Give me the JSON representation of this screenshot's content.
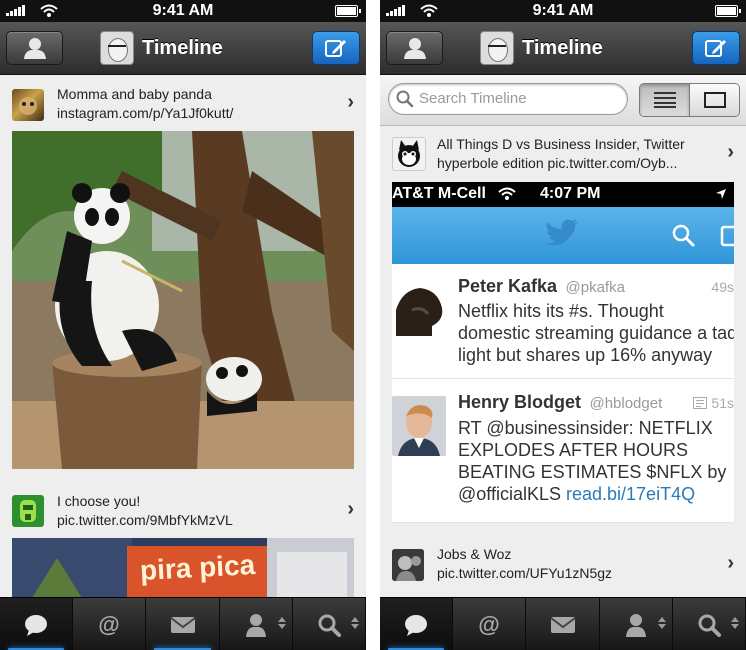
{
  "status_bar": {
    "time": "9:41 AM"
  },
  "nav": {
    "title": "Timeline"
  },
  "tabs": [
    {
      "name": "timeline",
      "icon": "speech-bubble-icon"
    },
    {
      "name": "mentions",
      "icon": "at-icon"
    },
    {
      "name": "messages",
      "icon": "envelope-icon"
    },
    {
      "name": "profile",
      "icon": "person-icon"
    },
    {
      "name": "search",
      "icon": "magnifier-icon"
    }
  ],
  "left": {
    "tweets": [
      {
        "line1": "Momma and baby panda",
        "line2": "instagram.com/p/Ya1Jf0kutt/"
      },
      {
        "line1": "I choose you!",
        "line2": "pic.twitter.com/9MbfYkMzVL"
      }
    ],
    "photo2_sign": "pira pica"
  },
  "right": {
    "search": {
      "placeholder": "Search Timeline"
    },
    "tweets": [
      {
        "line1": "All Things D vs Business Insider, Twitter",
        "line2": "hyperbole edition pic.twitter.com/Oyb..."
      },
      {
        "line1": "Jobs & Woz",
        "line2": "pic.twitter.com/UFYu1zN5gz"
      }
    ],
    "embed": {
      "carrier": "AT&T M-Cell",
      "time": "4:07 PM",
      "tweets": [
        {
          "name": "Peter Kafka",
          "handle": "@pkafka",
          "count": "49s",
          "lines": [
            "Netflix hits its #s. Thought",
            "domestic streaming guidance a tad",
            "light but shares up 16% anyway"
          ]
        },
        {
          "name": "Henry Blodget",
          "handle": "@hblodget",
          "count": "51s",
          "lines": [
            "RT @businessinsider: NETFLIX",
            "EXPLODES AFTER HOURS",
            "BEATING ESTIMATES $NFLX by"
          ],
          "last_text": "@officialKLS ",
          "link": "read.bi/17eiT4Q"
        }
      ]
    }
  },
  "colors": {
    "accent": "#2b8ce8",
    "nav_dark": "#2d2d2d",
    "compose_blue": "#1e78d6",
    "embed_blue": "#3fa3e0"
  }
}
